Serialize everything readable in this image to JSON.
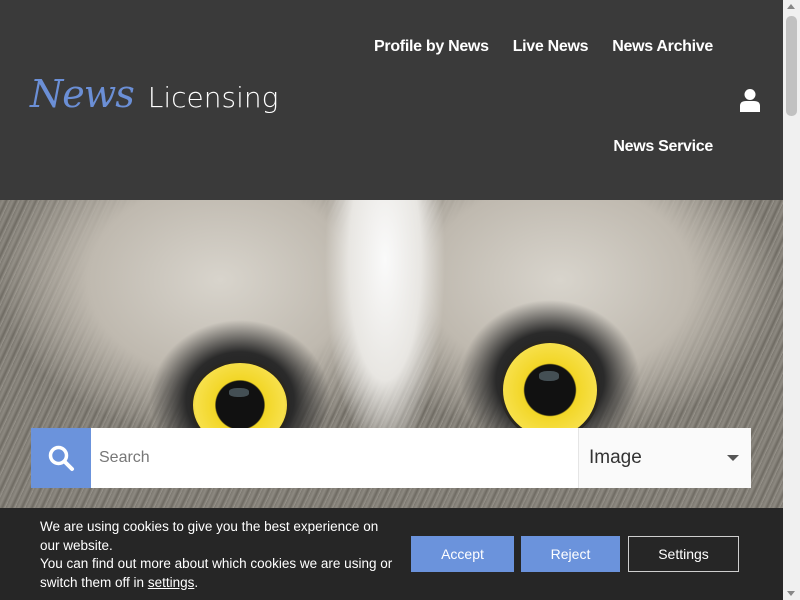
{
  "brand": {
    "script": "News",
    "text": "Licensing"
  },
  "nav": {
    "items": [
      "Profile by News",
      "Live News",
      "News Archive"
    ],
    "secondary": "News Service"
  },
  "icons": {
    "user": "user-icon",
    "search": "search-icon",
    "caret": "chevron-down-icon"
  },
  "search": {
    "placeholder": "Search",
    "type_selected": "Image"
  },
  "cookie": {
    "line1": "We are using cookies to give you the best experience on our website.",
    "line2": "You can find out more about which cookies we are using or switch them off in",
    "link": "settings",
    "period": ".",
    "accept": "Accept",
    "reject": "Reject",
    "settings": "Settings"
  },
  "colors": {
    "accent": "#6b93dc",
    "header_bg": "#3a3a3a",
    "banner_bg": "#262626"
  }
}
